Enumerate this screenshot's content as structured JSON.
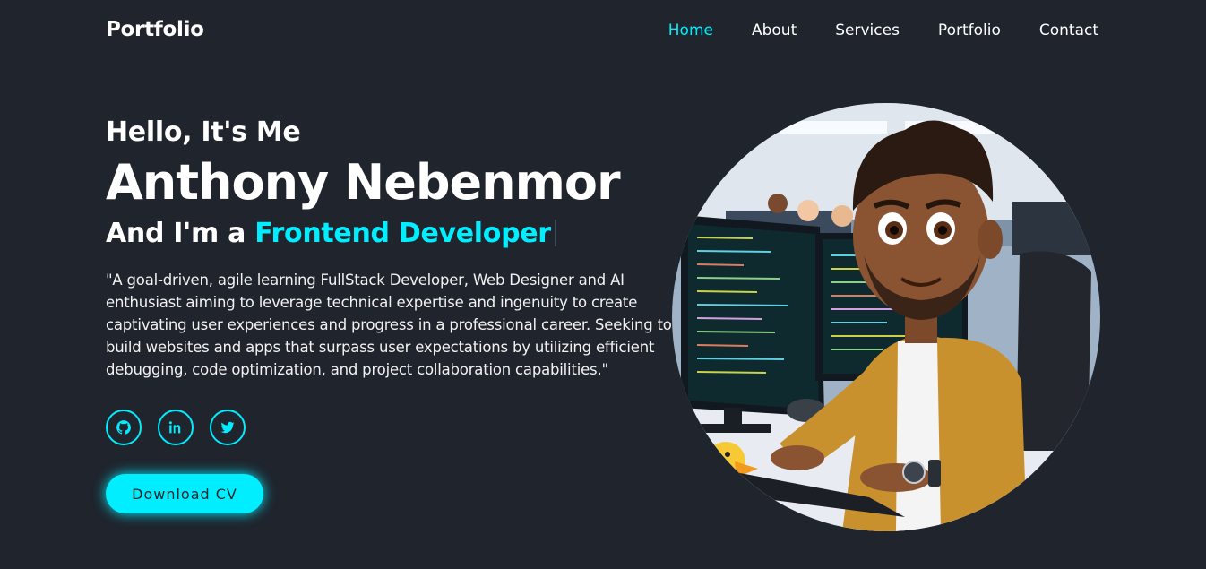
{
  "header": {
    "logo": "Portfolio",
    "nav": [
      {
        "label": "Home",
        "active": true
      },
      {
        "label": "About",
        "active": false
      },
      {
        "label": "Services",
        "active": false
      },
      {
        "label": "Portfolio",
        "active": false
      },
      {
        "label": "Contact",
        "active": false
      }
    ]
  },
  "hero": {
    "greeting": "Hello, It's Me",
    "name": "Anthony Nebenmor",
    "role_prefix": "And I'm a ",
    "role_highlight": "Frontend Developer",
    "bio": "\"A goal-driven, agile learning FullStack Developer, Web Designer and AI enthusiast aiming to leverage technical expertise and ingenuity to create captivating user experiences and progress in a professional career. Seeking to build websites and apps that surpass user expectations by utilizing efficient debugging, code optimization, and project collaboration capabilities.\"",
    "socials": [
      {
        "icon": "github-icon"
      },
      {
        "icon": "linkedin-icon"
      },
      {
        "icon": "twitter-icon"
      }
    ],
    "cta_label": "Download CV"
  },
  "colors": {
    "background": "#1f242d",
    "accent": "#00eeff",
    "text": "#ffffff"
  }
}
